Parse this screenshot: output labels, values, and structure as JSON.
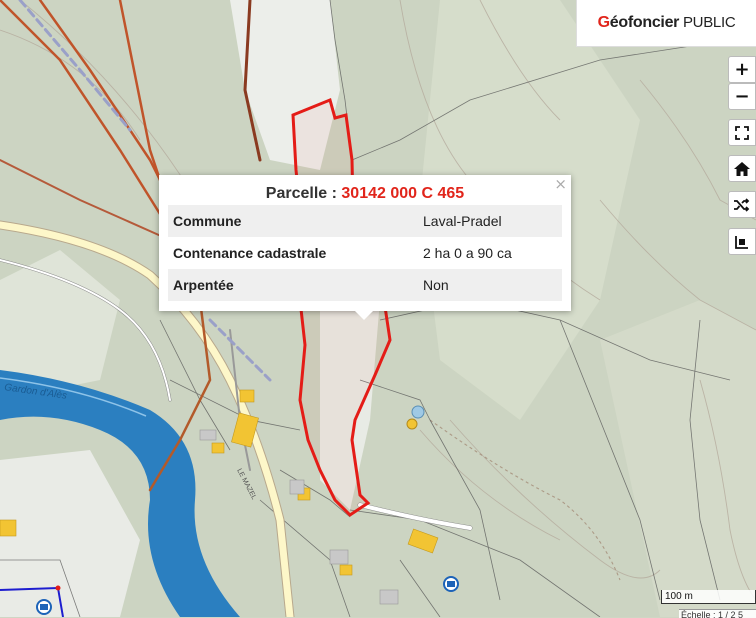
{
  "brand": {
    "logo_g": "G",
    "logo_name": "éofoncier",
    "logo_suffix": " PUBLIC"
  },
  "controls": {
    "zoom_in": "+",
    "zoom_out": "−",
    "fullscreen_icon": "fullscreen-icon",
    "home_icon": "home-icon",
    "shuffle_icon": "shuffle-icon",
    "layers_icon": "layers-icon"
  },
  "popup": {
    "title_prefix": "Parcelle : ",
    "parcel_ref": "30142 000 C 465",
    "close": "×",
    "rows": [
      {
        "key": "Commune",
        "value": "Laval-Pradel"
      },
      {
        "key": "Contenance cadastrale",
        "value": "2 ha 0 a 90 ca"
      },
      {
        "key": "Arpentée",
        "value": "Non"
      }
    ]
  },
  "map_labels": {
    "street": "LE MAZEL",
    "river": "Gardon d'Alès"
  },
  "scale": {
    "label": "100 m",
    "ratio": "Échelle : 1 / 2 5"
  },
  "colors": {
    "parcel": "#e1251b",
    "river": "#2b7fc0",
    "accent": "#e1251b"
  }
}
